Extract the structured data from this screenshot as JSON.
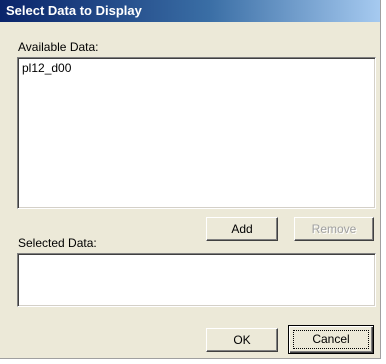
{
  "window": {
    "title": "Select Data to Display"
  },
  "available": {
    "label": "Available Data:",
    "items": [
      "pl12_d00"
    ]
  },
  "selected": {
    "label": "Selected Data:",
    "items": []
  },
  "buttons": {
    "add": "Add",
    "remove": "Remove",
    "ok": "OK",
    "cancel": "Cancel"
  }
}
